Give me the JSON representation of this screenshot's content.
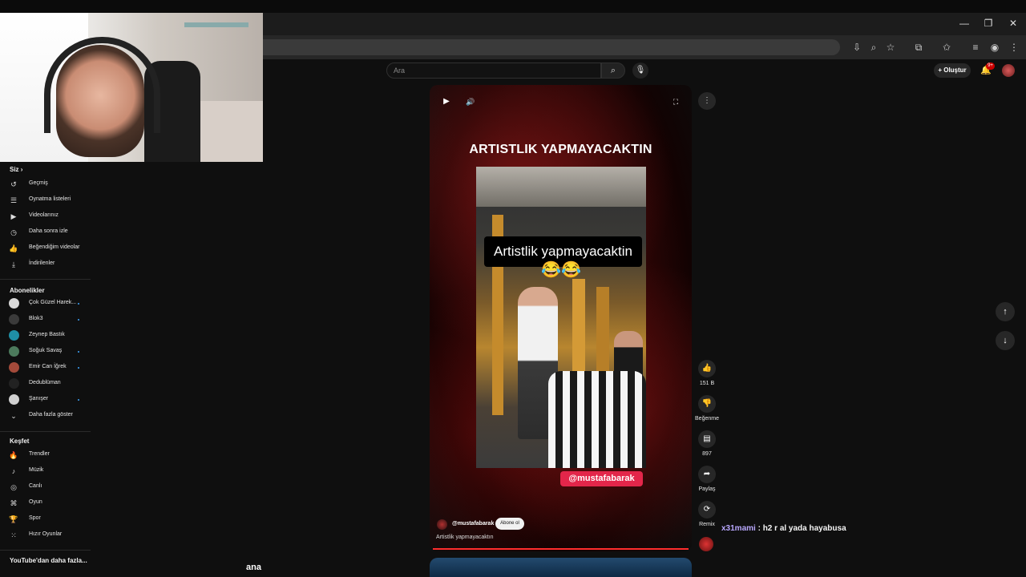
{
  "header": {
    "search_placeholder": "Ara",
    "create_label": "Oluştur",
    "notifications_badge": "9+"
  },
  "sidebar": {
    "you_title": "Siz",
    "you_items": [
      {
        "label": "Geçmiş",
        "icon": "history-icon"
      },
      {
        "label": "Oynatma listeleri",
        "icon": "playlist-icon"
      },
      {
        "label": "Videolarınız",
        "icon": "your-videos-icon"
      },
      {
        "label": "Daha sonra izle",
        "icon": "watch-later-icon"
      },
      {
        "label": "Beğendiğim videolar",
        "icon": "liked-icon"
      },
      {
        "label": "İndirilenler",
        "icon": "download-icon"
      }
    ],
    "subs_title": "Abonelikler",
    "subs_items": [
      {
        "label": "Çok Güzel Harek...",
        "color": "#d9d9d9"
      },
      {
        "label": "Blok3",
        "color": "#3a3a3a"
      },
      {
        "label": "Zeynep Bastık",
        "color": "#1f8fa6"
      },
      {
        "label": "Soğuk Savaş",
        "color": "#4c7a5c"
      },
      {
        "label": "Emir Can İğrek",
        "color": "#a34a3a"
      },
      {
        "label": "Dedublüman",
        "color": "#222222"
      },
      {
        "label": "Şanışer",
        "color": "#d0d0d0"
      }
    ],
    "show_more_label": "Daha fazla göster",
    "explore_title": "Keşfet",
    "explore_items": [
      {
        "label": "Trendler",
        "icon": "trending-icon"
      },
      {
        "label": "Müzik",
        "icon": "music-icon"
      },
      {
        "label": "Canlı",
        "icon": "live-icon"
      },
      {
        "label": "Oyun",
        "icon": "gaming-icon"
      },
      {
        "label": "Spor",
        "icon": "sports-icon"
      },
      {
        "label": "Hızır Oyunlar",
        "icon": "playables-icon"
      }
    ],
    "more_title": "YouTube'dan daha fazla..."
  },
  "short": {
    "title": "ARTISTLIK YAPMAYACAKTIN",
    "caption": "Artistlik yapmayacaktin",
    "emoji": "😂😂",
    "handle_overlay": "@mustafabarak",
    "channel": "@mustafabarak",
    "subscribe_label": "Abone ol",
    "description": "Artistlik yapmayacaktın"
  },
  "actions": {
    "like_count": "151 B",
    "dislike_label": "Beğenme",
    "comment_count": "897",
    "share_label": "Paylaş",
    "remix_label": "Remix"
  },
  "chat": {
    "user": "x31mami",
    "message": " : h2 r al yada hayabusa"
  },
  "overlay_text": "ana"
}
